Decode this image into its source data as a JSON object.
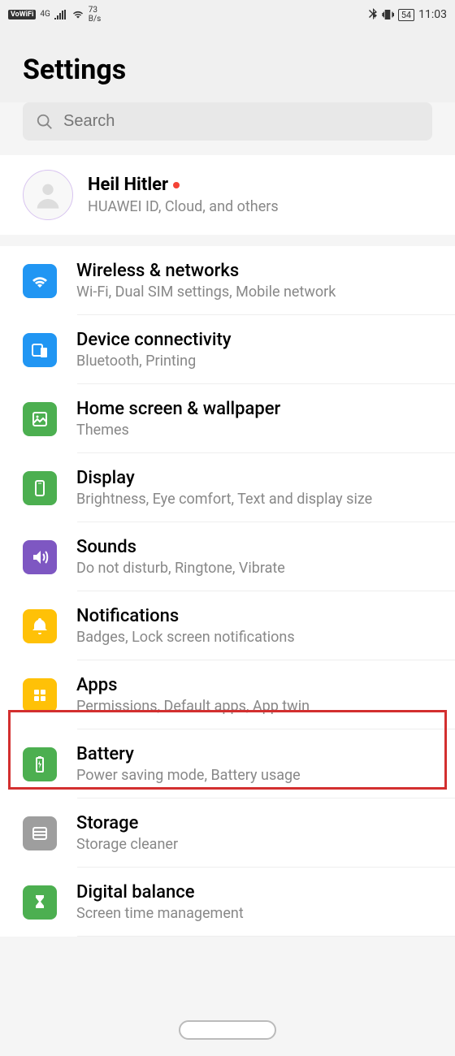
{
  "status": {
    "vowifi": "VoWiFi",
    "network": "4G",
    "speed_val": "73",
    "speed_unit": "B/s",
    "battery": "54",
    "time": "11:03"
  },
  "page_title": "Settings",
  "search": {
    "placeholder": "Search"
  },
  "account": {
    "name": "Heil Hitler",
    "subtitle": "HUAWEI ID, Cloud, and others"
  },
  "items": [
    {
      "title": "Wireless & networks",
      "sub": "Wi-Fi, Dual SIM settings, Mobile network",
      "color": "bg-blue",
      "icon": "wifi"
    },
    {
      "title": "Device connectivity",
      "sub": "Bluetooth, Printing",
      "color": "bg-blue",
      "icon": "devices"
    },
    {
      "title": "Home screen & wallpaper",
      "sub": "Themes",
      "color": "bg-green",
      "icon": "image"
    },
    {
      "title": "Display",
      "sub": "Brightness, Eye comfort, Text and display size",
      "color": "bg-green",
      "icon": "phone"
    },
    {
      "title": "Sounds",
      "sub": "Do not disturb, Ringtone, Vibrate",
      "color": "bg-purple",
      "icon": "sound"
    },
    {
      "title": "Notifications",
      "sub": "Badges, Lock screen notifications",
      "color": "bg-yellow",
      "icon": "bell"
    },
    {
      "title": "Apps",
      "sub": "Permissions, Default apps, App twin",
      "color": "bg-yellow",
      "icon": "grid"
    },
    {
      "title": "Battery",
      "sub": "Power saving mode, Battery usage",
      "color": "bg-green",
      "icon": "battery"
    },
    {
      "title": "Storage",
      "sub": "Storage cleaner",
      "color": "bg-gray",
      "icon": "storage"
    },
    {
      "title": "Digital balance",
      "sub": "Screen time management",
      "color": "bg-green",
      "icon": "hourglass"
    }
  ]
}
